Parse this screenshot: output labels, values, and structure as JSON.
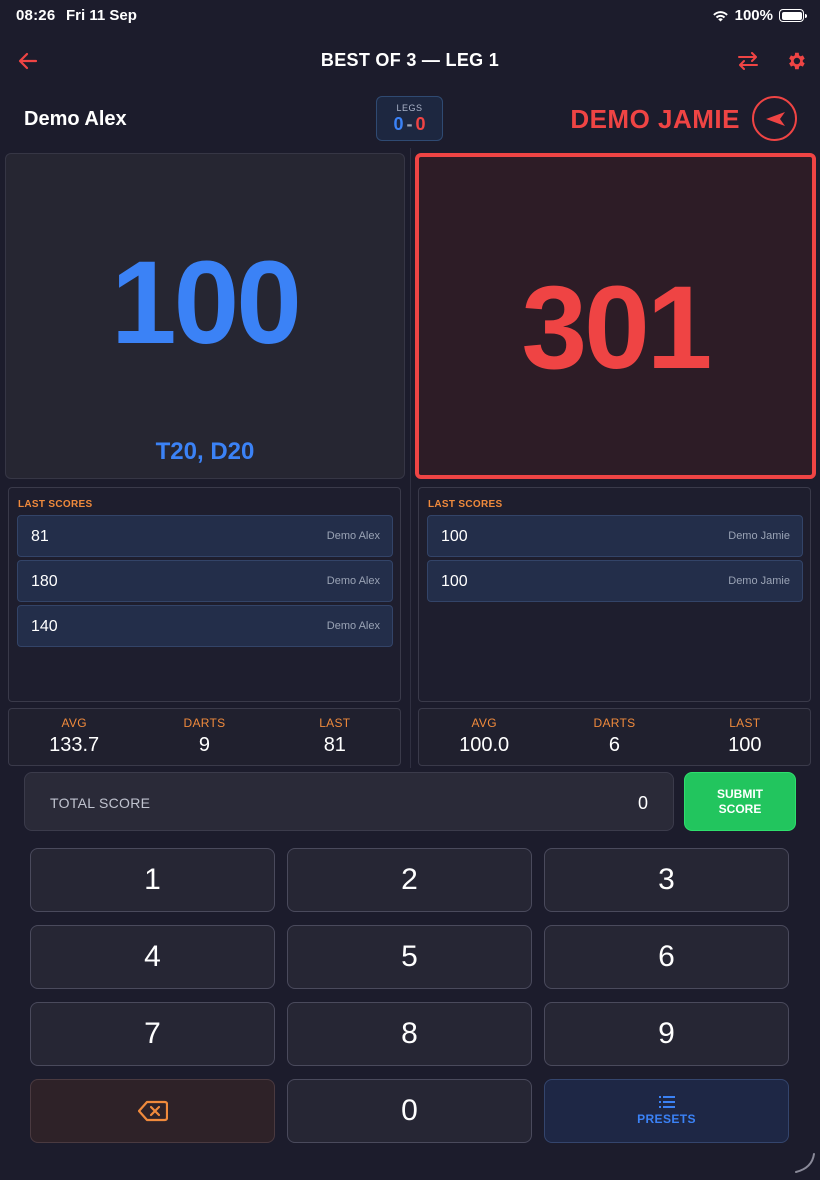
{
  "status_bar": {
    "time": "08:26",
    "date": "Fri 11 Sep",
    "battery": "100%"
  },
  "header": {
    "title": "BEST OF 3 — LEG 1",
    "icons": [
      "back-arrow-icon",
      "swap-icon",
      "gear-icon"
    ]
  },
  "players": {
    "left": {
      "name": "Demo Alex"
    },
    "right": {
      "name": "DEMO JAMIE"
    }
  },
  "legs": {
    "label": "LEGS",
    "left": "0",
    "separator": "-",
    "right": "0"
  },
  "scores": {
    "left": {
      "remaining": "100",
      "checkout": "T20, D20"
    },
    "right": {
      "remaining": "301"
    }
  },
  "last_scores": {
    "title": "LAST SCORES",
    "left": [
      {
        "value": "81",
        "player": "Demo Alex"
      },
      {
        "value": "180",
        "player": "Demo Alex"
      },
      {
        "value": "140",
        "player": "Demo Alex"
      }
    ],
    "right": [
      {
        "value": "100",
        "player": "Demo Jamie"
      },
      {
        "value": "100",
        "player": "Demo Jamie"
      }
    ]
  },
  "stats": {
    "labels": {
      "avg": "AVG",
      "darts": "DARTS",
      "last": "LAST"
    },
    "left": {
      "avg": "133.7",
      "darts": "9",
      "last": "81"
    },
    "right": {
      "avg": "100.0",
      "darts": "6",
      "last": "100"
    }
  },
  "input": {
    "label": "TOTAL SCORE",
    "value": "0",
    "submit": "SUBMIT\nSCORE"
  },
  "keypad": {
    "keys": [
      "1",
      "2",
      "3",
      "4",
      "5",
      "6",
      "7",
      "8",
      "9",
      "0"
    ],
    "presets_label": "PRESETS"
  },
  "colors": {
    "accent_red": "#ef4444",
    "accent_blue": "#3b82f6",
    "accent_orange": "#f08a3c",
    "submit_green": "#22c55e",
    "background": "#1c1c2c"
  }
}
